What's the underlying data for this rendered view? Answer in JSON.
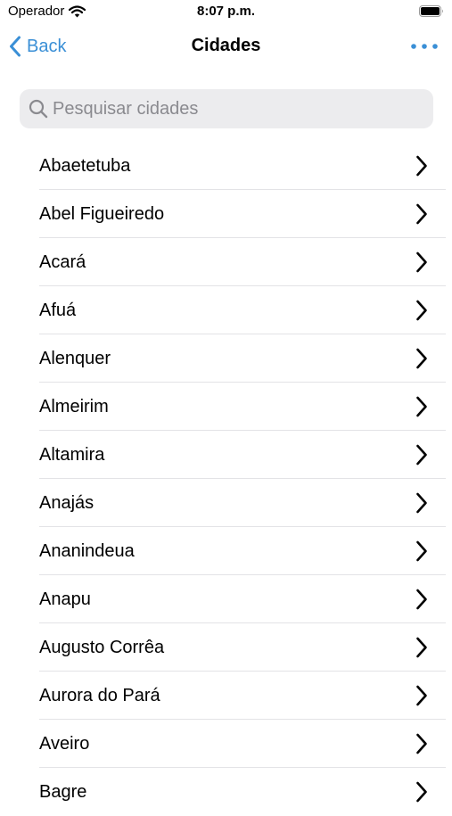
{
  "status_bar": {
    "carrier": "Operador",
    "time": "8:07 p.m.",
    "wifi_icon": "wifi-icon",
    "battery_icon": "battery-icon"
  },
  "nav": {
    "back_label": "Back",
    "title": "Cidades",
    "more_icon": "more-icon",
    "accent_color": "#3a8fd6"
  },
  "search": {
    "placeholder": "Pesquisar cidades",
    "value": ""
  },
  "cities": [
    {
      "label": "Abaetetuba"
    },
    {
      "label": "Abel Figueiredo"
    },
    {
      "label": "Acará"
    },
    {
      "label": "Afuá"
    },
    {
      "label": "Alenquer"
    },
    {
      "label": "Almeirim"
    },
    {
      "label": "Altamira"
    },
    {
      "label": "Anajás"
    },
    {
      "label": "Ananindeua"
    },
    {
      "label": "Anapu"
    },
    {
      "label": "Augusto Corrêa"
    },
    {
      "label": "Aurora do Pará"
    },
    {
      "label": "Aveiro"
    },
    {
      "label": "Bagre"
    }
  ]
}
